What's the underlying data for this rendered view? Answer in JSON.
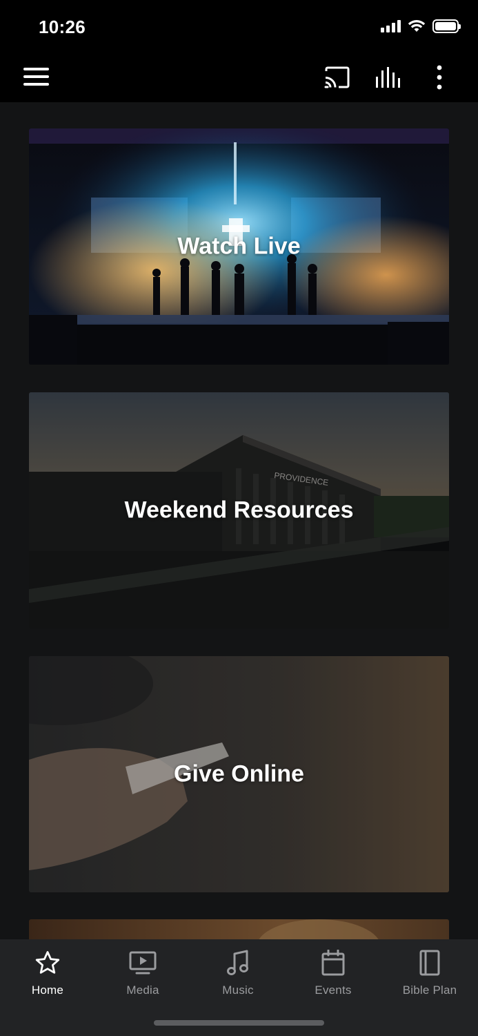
{
  "status_bar": {
    "time": "10:26"
  },
  "header": {
    "icons": [
      "hamburger-menu-icon",
      "cast-icon",
      "audio-bars-icon",
      "more-vertical-icon"
    ]
  },
  "cards": {
    "watch_live": "Watch Live",
    "weekend_resources": "Weekend Resources",
    "give_online": "Give Online"
  },
  "tabs": [
    {
      "label": "Home",
      "icon": "star-icon",
      "active": true
    },
    {
      "label": "Media",
      "icon": "tv-icon",
      "active": false
    },
    {
      "label": "Music",
      "icon": "music-note-icon",
      "active": false
    },
    {
      "label": "Events",
      "icon": "calendar-icon",
      "active": false
    },
    {
      "label": "Bible Plan",
      "icon": "book-icon",
      "active": false
    }
  ],
  "colors": {
    "background": "#141516",
    "header": "#000000",
    "tab_bar": "#222325",
    "tab_inactive": "#9b9c9f",
    "tab_active": "#ffffff"
  }
}
